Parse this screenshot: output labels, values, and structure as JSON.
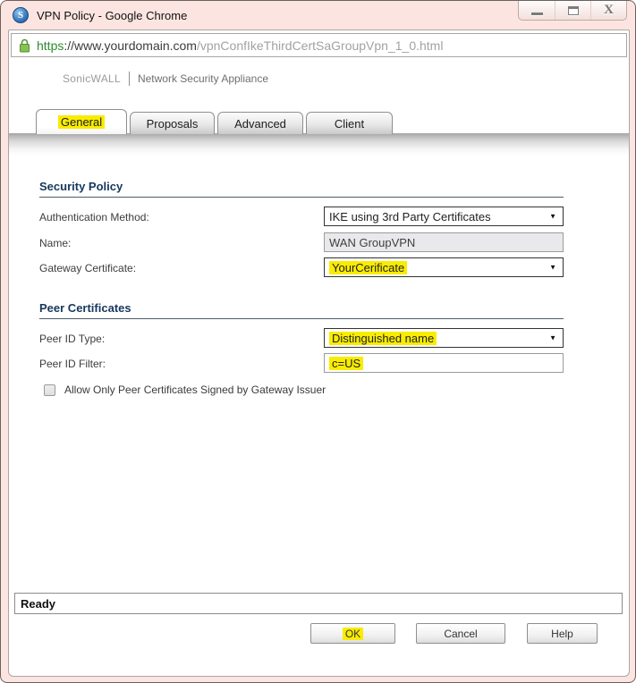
{
  "window": {
    "title": "VPN Policy - Google Chrome",
    "controls": {
      "minimize": "minimize",
      "maximize": "maximize",
      "close": "close"
    }
  },
  "urlbar": {
    "scheme": "https",
    "separator": "://",
    "domain": "www.yourdomain.com",
    "path": "/vpnConfIkeThirdCertSaGroupVpn_1_0.html"
  },
  "brand": {
    "name": "SonicWALL",
    "product": "Network Security Appliance"
  },
  "tabs": [
    {
      "label": "General",
      "active": true,
      "highlighted": true
    },
    {
      "label": "Proposals",
      "active": false,
      "highlighted": false
    },
    {
      "label": "Advanced",
      "active": false,
      "highlighted": false
    },
    {
      "label": "Client",
      "active": false,
      "highlighted": false
    }
  ],
  "security_policy": {
    "title": "Security Policy",
    "auth_method": {
      "label": "Authentication Method:",
      "value": "IKE using 3rd Party Certificates",
      "type": "select",
      "highlighted": false
    },
    "name": {
      "label": "Name:",
      "value": "WAN GroupVPN",
      "type": "text-readonly",
      "highlighted": false
    },
    "gateway_cert": {
      "label": "Gateway Certificate:",
      "value": "YourCerificate",
      "type": "select",
      "highlighted": true
    }
  },
  "peer_certificates": {
    "title": "Peer Certificates",
    "peer_id_type": {
      "label": "Peer ID Type:",
      "value": "Distinguished name",
      "type": "select",
      "highlighted": true
    },
    "peer_id_filter": {
      "label": "Peer ID Filter:",
      "value": "c=US",
      "type": "text",
      "highlighted": true
    },
    "signed_by_issuer": {
      "label": "Allow Only Peer Certificates Signed by Gateway Issuer",
      "checked": false
    }
  },
  "statusbar": {
    "text": "Ready"
  },
  "buttons": {
    "ok": "OK",
    "cancel": "Cancel",
    "help": "Help"
  },
  "colors": {
    "highlight": "#f9ec00",
    "titlebar_frame": "#fce5e1",
    "section_heading": "#17375d",
    "url_scheme_green": "#2d8b2d",
    "icon_blue": "#1c4f8e",
    "lock_green": "#79b746"
  }
}
